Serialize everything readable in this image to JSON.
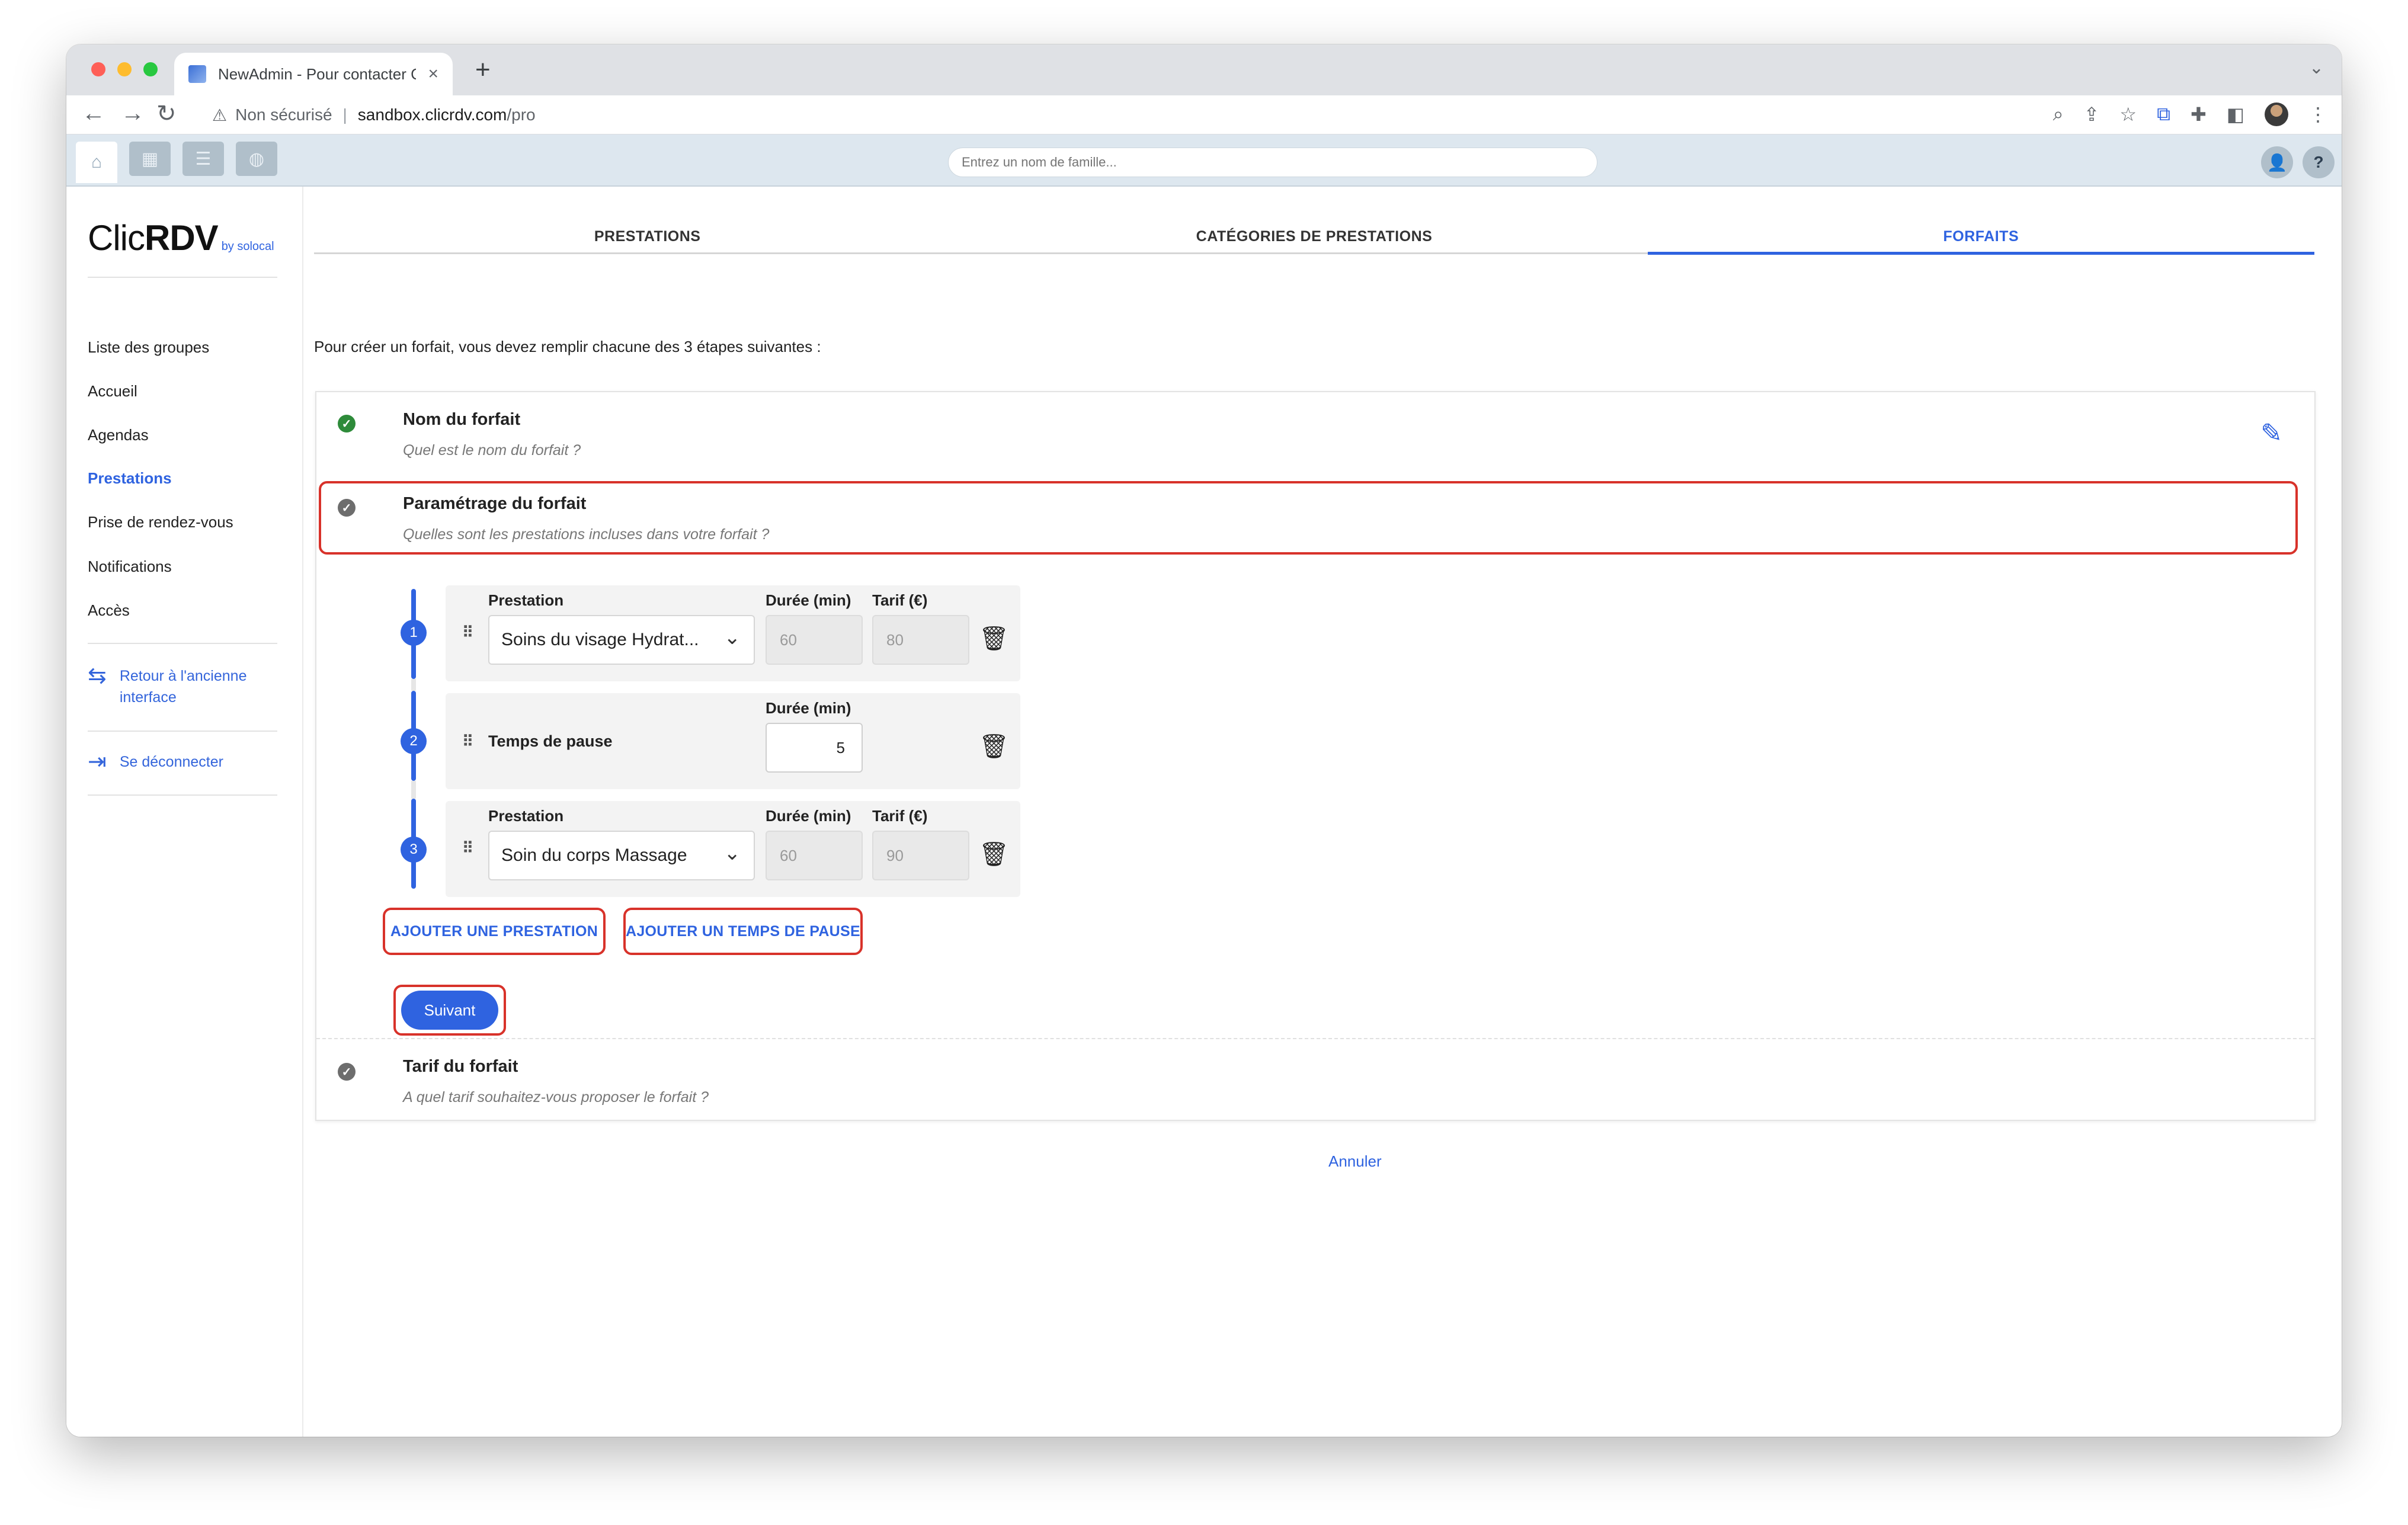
{
  "browser": {
    "tab_title": "NewAdmin - Pour contacter Cli",
    "tab_close": "×",
    "new_tab": "+",
    "tab_menu": "⌄",
    "nav_back": "←",
    "nav_forward": "→",
    "nav_reload": "↻",
    "security_label": "Non sécurisé",
    "url_host": "sandbox.clicrdv.com",
    "url_path": "/pro",
    "toolbar_icons": [
      "zoom-icon",
      "share-icon",
      "star-icon",
      "sync-icon",
      "extensions-icon",
      "sidebar-icon",
      "profile-avatar",
      "kebab-menu-icon"
    ]
  },
  "appbar": {
    "search_placeholder": "Entrez un nom de famille...",
    "icons": [
      "home-icon",
      "calendar-icon",
      "list-icon",
      "globe-icon"
    ],
    "user_icon": "👤",
    "help_icon": "?"
  },
  "sidebar": {
    "logo_main": "Clic",
    "logo_bold": "RDV",
    "logo_sub": "by solocal",
    "items": [
      {
        "label": "Liste des groupes"
      },
      {
        "label": "Accueil"
      },
      {
        "label": "Agendas"
      },
      {
        "label": "Prestations",
        "active": true
      },
      {
        "label": "Prise de rendez-vous"
      },
      {
        "label": "Notifications"
      },
      {
        "label": "Accès"
      }
    ],
    "back_link_line1": "Retour à l'ancienne",
    "back_link_line2": "interface",
    "logout": "Se déconnecter"
  },
  "main": {
    "tabs": [
      {
        "label": "PRESTATIONS"
      },
      {
        "label": "CATÉGORIES DE PRESTATIONS"
      },
      {
        "label": "FORFAITS",
        "active": true
      }
    ],
    "intro": "Pour créer un forfait, vous devez remplir chacune des 3 étapes suivantes :",
    "steps": [
      {
        "title": "Nom du forfait",
        "subtitle": "Quel est le nom du forfait ?",
        "status": "done"
      },
      {
        "title": "Paramétrage du forfait",
        "subtitle": "Quelles sont les prestations incluses dans votre forfait ?",
        "status": "current"
      },
      {
        "title": "Tarif du forfait",
        "subtitle": "A quel tarif souhaitez-vous proposer le forfait ?",
        "status": "pending"
      }
    ],
    "rows": [
      {
        "number": "1",
        "type": "prestation",
        "label": "Prestation",
        "duration_label": "Durée (min)",
        "price_label": "Tarif (€)",
        "selected": "Soins du visage Hydrat...",
        "duration": "60",
        "price": "80"
      },
      {
        "number": "2",
        "type": "pause",
        "label": "Temps de pause",
        "duration_label": "Durée (min)",
        "duration": "5"
      },
      {
        "number": "3",
        "type": "prestation",
        "label": "Prestation",
        "duration_label": "Durée (min)",
        "price_label": "Tarif (€)",
        "selected": "Soin du corps Massage",
        "duration": "60",
        "price": "90"
      }
    ],
    "add_prestation": "AJOUTER UNE PRESTATION",
    "add_pause": "AJOUTER UN TEMPS DE PAUSE",
    "next": "Suivant",
    "cancel": "Annuler"
  },
  "colors": {
    "accent": "#2f63e0",
    "highlight": "#d8322a",
    "success": "#2e8b3a"
  }
}
